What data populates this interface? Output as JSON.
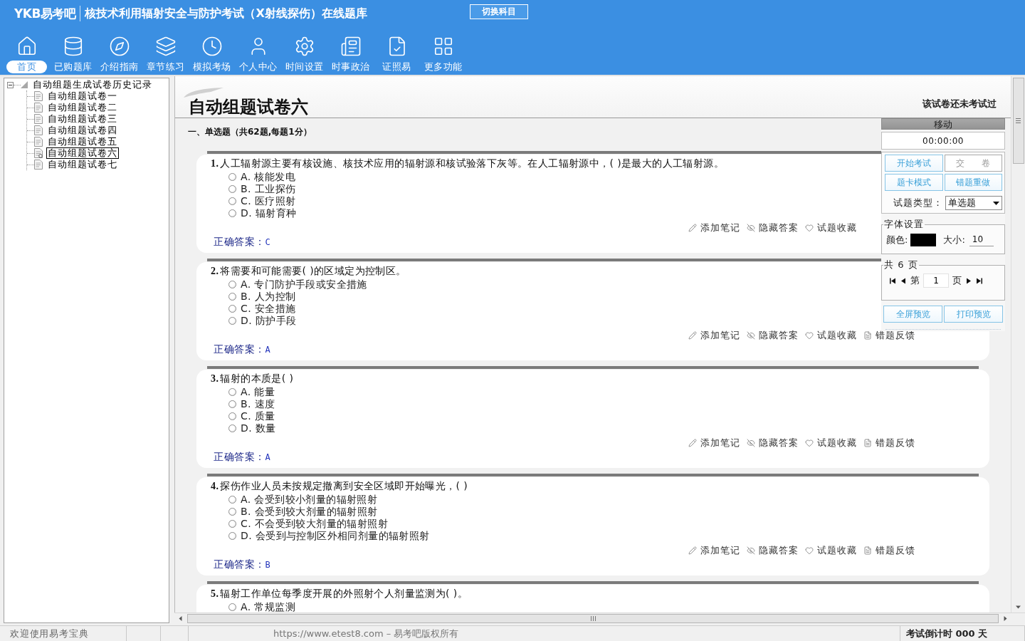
{
  "header": {
    "logo": "YKB易考吧",
    "title": "核技术利用辐射安全与防护考试（X射线探伤）在线题库",
    "switch_button": "切换科目"
  },
  "nav": [
    {
      "label": "首页",
      "selected": true
    },
    {
      "label": "已购题库",
      "selected": false
    },
    {
      "label": "介绍指南",
      "selected": false
    },
    {
      "label": "章节练习",
      "selected": false
    },
    {
      "label": "模拟考场",
      "selected": false
    },
    {
      "label": "个人中心",
      "selected": false
    },
    {
      "label": "时间设置",
      "selected": false
    },
    {
      "label": "时事政治",
      "selected": false
    },
    {
      "label": "证照易",
      "selected": false
    },
    {
      "label": "更多功能",
      "selected": false
    }
  ],
  "tree": {
    "label": "自动组题生成试卷历史记录",
    "expanded": true,
    "children": [
      {
        "label": "自动组题试卷一",
        "selected": false
      },
      {
        "label": "自动组题试卷二",
        "selected": false
      },
      {
        "label": "自动组题试卷三",
        "selected": false
      },
      {
        "label": "自动组题试卷四",
        "selected": false
      },
      {
        "label": "自动组题试卷五",
        "selected": false
      },
      {
        "label": "自动组题试卷六",
        "selected": true
      },
      {
        "label": "自动组题试卷七",
        "selected": false
      }
    ]
  },
  "paper": {
    "title": "自动组题试卷六",
    "status": "该试卷还未考试过",
    "section": "一、单选题（共62题,每题1分）"
  },
  "questions": [
    {
      "number": "1.",
      "text": "人工辐射源主要有核设施、核技术应用的辐射源和核试验落下灰等。在人工辐射源中，( )是最大的人工辐射源。",
      "options": [
        {
          "label": "A. 核能发电",
          "selected": false
        },
        {
          "label": "B. 工业探伤",
          "selected": false
        },
        {
          "label": "C. 医疗照射",
          "selected": false
        },
        {
          "label": "D. 辐射育种",
          "selected": false
        }
      ],
      "actions": [
        {
          "kind": "note",
          "label": "添加笔记"
        },
        {
          "kind": "hide",
          "label": "隐藏答案"
        },
        {
          "kind": "favorite",
          "label": "试题收藏"
        }
      ],
      "answer_label": "正确答案：",
      "answer": "C"
    },
    {
      "number": "2.",
      "text": "将需要和可能需要( )的区域定为控制区。",
      "options": [
        {
          "label": "A. 专门防护手段或安全措施",
          "selected": false
        },
        {
          "label": "B. 人为控制",
          "selected": false
        },
        {
          "label": "C. 安全措施",
          "selected": false
        },
        {
          "label": "D. 防护手段",
          "selected": false
        }
      ],
      "actions": [
        {
          "kind": "note",
          "label": "添加笔记"
        },
        {
          "kind": "hide",
          "label": "隐藏答案"
        },
        {
          "kind": "favorite",
          "label": "试题收藏"
        },
        {
          "kind": "feedback",
          "label": "错题反馈"
        }
      ],
      "answer_label": "正确答案：",
      "answer": "A"
    },
    {
      "number": "3.",
      "text": "辐射的本质是( )",
      "options": [
        {
          "label": "A. 能量",
          "selected": false
        },
        {
          "label": "B. 速度",
          "selected": false
        },
        {
          "label": "C. 质量",
          "selected": false
        },
        {
          "label": "D. 数量",
          "selected": false
        }
      ],
      "actions": [
        {
          "kind": "note",
          "label": "添加笔记"
        },
        {
          "kind": "hide",
          "label": "隐藏答案"
        },
        {
          "kind": "favorite",
          "label": "试题收藏"
        },
        {
          "kind": "feedback",
          "label": "错题反馈"
        }
      ],
      "answer_label": "正确答案：",
      "answer": "A"
    },
    {
      "number": "4.",
      "text": "探伤作业人员未按规定撤离到安全区域即开始曝光，( )",
      "options": [
        {
          "label": "A. 会受到较小剂量的辐射照射",
          "selected": false
        },
        {
          "label": "B. 会受到较大剂量的辐射照射",
          "selected": false
        },
        {
          "label": "C. 不会受到较大剂量的辐射照射",
          "selected": false
        },
        {
          "label": "D. 会受到与控制区外相同剂量的辐射照射",
          "selected": false
        }
      ],
      "actions": [
        {
          "kind": "note",
          "label": "添加笔记"
        },
        {
          "kind": "hide",
          "label": "隐藏答案"
        },
        {
          "kind": "favorite",
          "label": "试题收藏"
        },
        {
          "kind": "feedback",
          "label": "错题反馈"
        }
      ],
      "answer_label": "正确答案：",
      "answer": "B"
    },
    {
      "number": "5.",
      "text": "辐射工作单位每季度开展的外照射个人剂量监测为( )。",
      "options": [
        {
          "label": "A. 常规监测",
          "selected": false
        }
      ]
    }
  ],
  "panel": {
    "title": "移动",
    "timer": "00:00:00",
    "buttons": [
      {
        "label": "开始考试",
        "disabled": false
      },
      {
        "label": "交　　卷",
        "disabled": true
      },
      {
        "label": "题卡模式",
        "disabled": false
      },
      {
        "label": "错题重做",
        "disabled": false
      }
    ],
    "type_label": "试题类型：",
    "type_value": "单选题",
    "font_legend": "字体设置",
    "color_label": "颜色:",
    "size_label": "大小:",
    "size_value": "10",
    "pager_legend": "共 6 页",
    "page_prefix": "第",
    "page_value": "1",
    "page_suffix": "页",
    "preview_buttons": [
      {
        "label": "全屏预览",
        "disabled": false
      },
      {
        "label": "打印预览",
        "disabled": false
      }
    ]
  },
  "status_bar": {
    "welcome": "欢迎使用易考宝典",
    "copyright": "https://www.etest8.com – 易考吧版权所有",
    "countdown": "考试倒计时 000 天"
  }
}
